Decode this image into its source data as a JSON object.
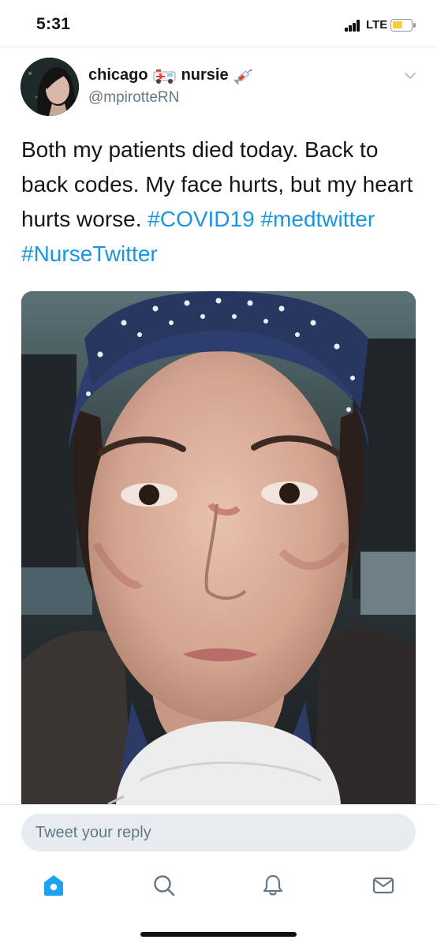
{
  "status_bar": {
    "time": "5:31",
    "network": "LTE",
    "battery_level": 0.45,
    "battery_color": "#f4d03f"
  },
  "tweet": {
    "display_name_part1": "chicago",
    "display_name_part2": "nursie",
    "name_emojis": [
      "ambulance-emoji",
      "syringe-emoji"
    ],
    "handle": "@mpirotteRN",
    "text_plain": "Both my patients died today. Back to back codes. My face hurts, but my heart hurts worse.",
    "hashtags": [
      "#COVID19",
      "#medtwitter",
      "#NurseTwitter"
    ],
    "hashtag_color": "#1b95e0"
  },
  "reply": {
    "placeholder": "Tweet your reply"
  },
  "tab_bar": {
    "items": [
      "home-icon",
      "search-icon",
      "notifications-icon",
      "messages-icon"
    ],
    "active_color": "#1da1f2",
    "inactive_color": "#657786"
  }
}
